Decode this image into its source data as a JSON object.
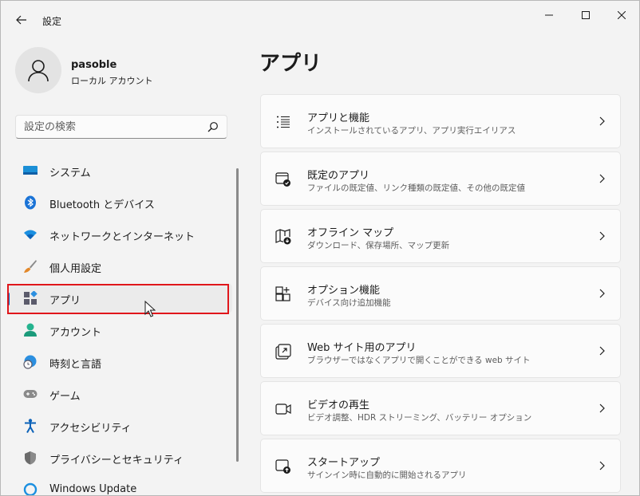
{
  "window": {
    "title": "設定"
  },
  "profile": {
    "name": "pasoble",
    "account_type": "ローカル アカウント"
  },
  "search": {
    "placeholder": "設定の検索"
  },
  "nav": {
    "items": [
      {
        "label": "システム",
        "icon": "system-icon"
      },
      {
        "label": "Bluetooth とデバイス",
        "icon": "bluetooth-icon"
      },
      {
        "label": "ネットワークとインターネット",
        "icon": "wifi-icon"
      },
      {
        "label": "個人用設定",
        "icon": "brush-icon"
      },
      {
        "label": "アプリ",
        "icon": "apps-icon",
        "active": true
      },
      {
        "label": "アカウント",
        "icon": "account-icon"
      },
      {
        "label": "時刻と言語",
        "icon": "clock-globe-icon"
      },
      {
        "label": "ゲーム",
        "icon": "gamepad-icon"
      },
      {
        "label": "アクセシビリティ",
        "icon": "accessibility-icon"
      },
      {
        "label": "プライバシーとセキュリティ",
        "icon": "shield-icon"
      },
      {
        "label": "Windows Update",
        "icon": "windows-update-icon"
      }
    ]
  },
  "main": {
    "title": "アプリ",
    "cards": [
      {
        "title": "アプリと機能",
        "subtitle": "インストールされているアプリ、アプリ実行エイリアス",
        "icon": "list-icon"
      },
      {
        "title": "既定のアプリ",
        "subtitle": "ファイルの既定値、リンク種類の既定値、その他の既定値",
        "icon": "default-apps-icon"
      },
      {
        "title": "オフライン マップ",
        "subtitle": "ダウンロード、保存場所、マップ更新",
        "icon": "offline-map-icon"
      },
      {
        "title": "オプション機能",
        "subtitle": "デバイス向け追加機能",
        "icon": "optional-features-icon"
      },
      {
        "title": "Web サイト用のアプリ",
        "subtitle": "ブラウザーではなくアプリで開くことができる web サイト",
        "icon": "web-app-icon"
      },
      {
        "title": "ビデオの再生",
        "subtitle": "ビデオ調整、HDR ストリーミング、バッテリー オプション",
        "icon": "video-icon"
      },
      {
        "title": "スタートアップ",
        "subtitle": "サインイン時に自動的に開始されるアプリ",
        "icon": "startup-icon"
      }
    ]
  },
  "colors": {
    "accent": "#0067c0",
    "highlight": "#e0161b"
  }
}
